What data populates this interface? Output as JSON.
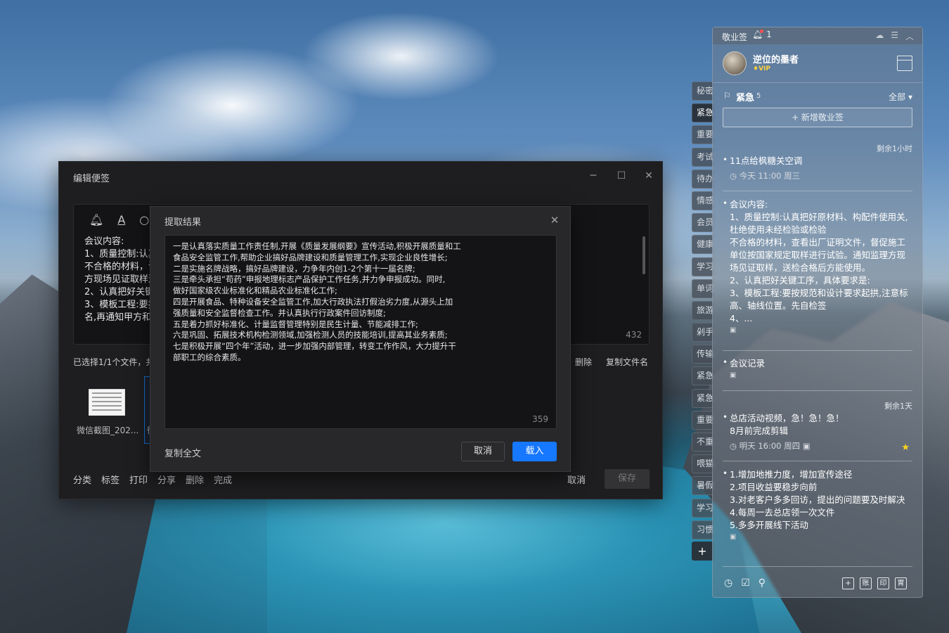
{
  "edit_window": {
    "title": "编辑便签",
    "controls": {
      "minimize": "─",
      "maximize": "☐",
      "close": "✕"
    },
    "editor_text": "会议内容:\n1、质量控制:认真\n不合格的材料，请\n方现场见证取样送\n2、认真把好关键\n3、模板工程:要按\n名,再通知甲方和",
    "editor_count": "432",
    "selected_info": "已选择1/1个文件，共",
    "file_actions": [
      "删除",
      "复制文件名"
    ],
    "thumbnail_name": "微信截图_202...",
    "thumbnail_name_2": "徐",
    "bottom_actions": [
      "分类",
      "标签",
      "打印",
      "分享",
      "删除",
      "完成"
    ],
    "cancel": "取消",
    "save": "保存"
  },
  "extract_dialog": {
    "title": "提取结果",
    "text": "一是认真落实质量工作责任制,开展《质量发展纲要》宣传活动,积极开展质量和工\n食品安全监管工作,帮助企业搞好品牌建设和质量管理工作,实现企业良性增长;\n二是实施名牌战略，搞好品牌建设，力争年内创1-2个第十一届名牌;\n三是牵头承担“苟药”申报地理标志产品保护工作任务,并力争申报成功。同时,\n做好国家级农业标准化和精品农业标准化工作;\n四是开展食品、特种设备安全监管工作,加大行政执法打假治劣力度,从源头上加\n强质量和安全监督检查工作。并认真执行行政案件回访制度;\n五是着力抓好标准化、计量监督管理特别是民生计量、节能减排工作;\n六是巩固、拓展技术机构检测领域,加强检测人员的技能培训,提高其业务素质;\n七是积极开展“四个年”活动，进一步加强内部管理，转变工作作风，大力提升干\n部职工的综合素质。",
    "count": "359",
    "copy_all": "复制全文",
    "cancel": "取消",
    "load": "载入"
  },
  "side_tabs": [
    "秘密",
    "紧急",
    "重要",
    "考试",
    "待办",
    "情感",
    "会员",
    "健康",
    "学习",
    "单词",
    "旅游",
    "剁手",
    "传输",
    "紧急",
    "紧急",
    "重要",
    "不重",
    "喂猫",
    "暑假",
    "学习",
    "习惯"
  ],
  "side_add": "+",
  "panel": {
    "app_name": "敬业签",
    "notif_count": "1",
    "username": "逆位的墨者",
    "vip": "VIP",
    "category": "紧急",
    "category_count": "5",
    "filter": "全部 ▾",
    "add_note": "+ 新增敬业签",
    "notes": [
      {
        "remain": "剩余1小时",
        "text": "11点给枫糖关空调",
        "meta": "今天 11:00 周三"
      },
      {
        "text": "会议内容:\n1、质量控制:认真把好原材料、构配件使用关,杜绝使用未经检验或检验\n不合格的材料，查看出厂证明文件，督促施工单位按国家规定取样进行试验。通知监理方现场见证取样，送检合格后方能使用。\n2、认真把好关键工序，具体要求是:\n3、模板工程:要按规范和设计要求起拱,注意标高、轴线位置。先自检签\n4、..."
      },
      {
        "text": "会议记录"
      },
      {
        "remain": "剩余1天",
        "text": "总店活动视频，急！急！急！\n8月前完成剪辑",
        "meta": "明天 16:00 周四"
      },
      {
        "text": "1.增加地推力度，增加宣传途径\n2.项目收益要稳步向前\n3.对老客户多多回访，提出的问题要及时解决\n4.每周一去总店领一次文件\n5.多多开展线下活动"
      }
    ],
    "footer_right": [
      "+",
      "账",
      "印",
      "胃"
    ]
  },
  "colors": {
    "accent": "#1677ff",
    "star": "#ffd21f",
    "vip": "#ffd23e"
  }
}
